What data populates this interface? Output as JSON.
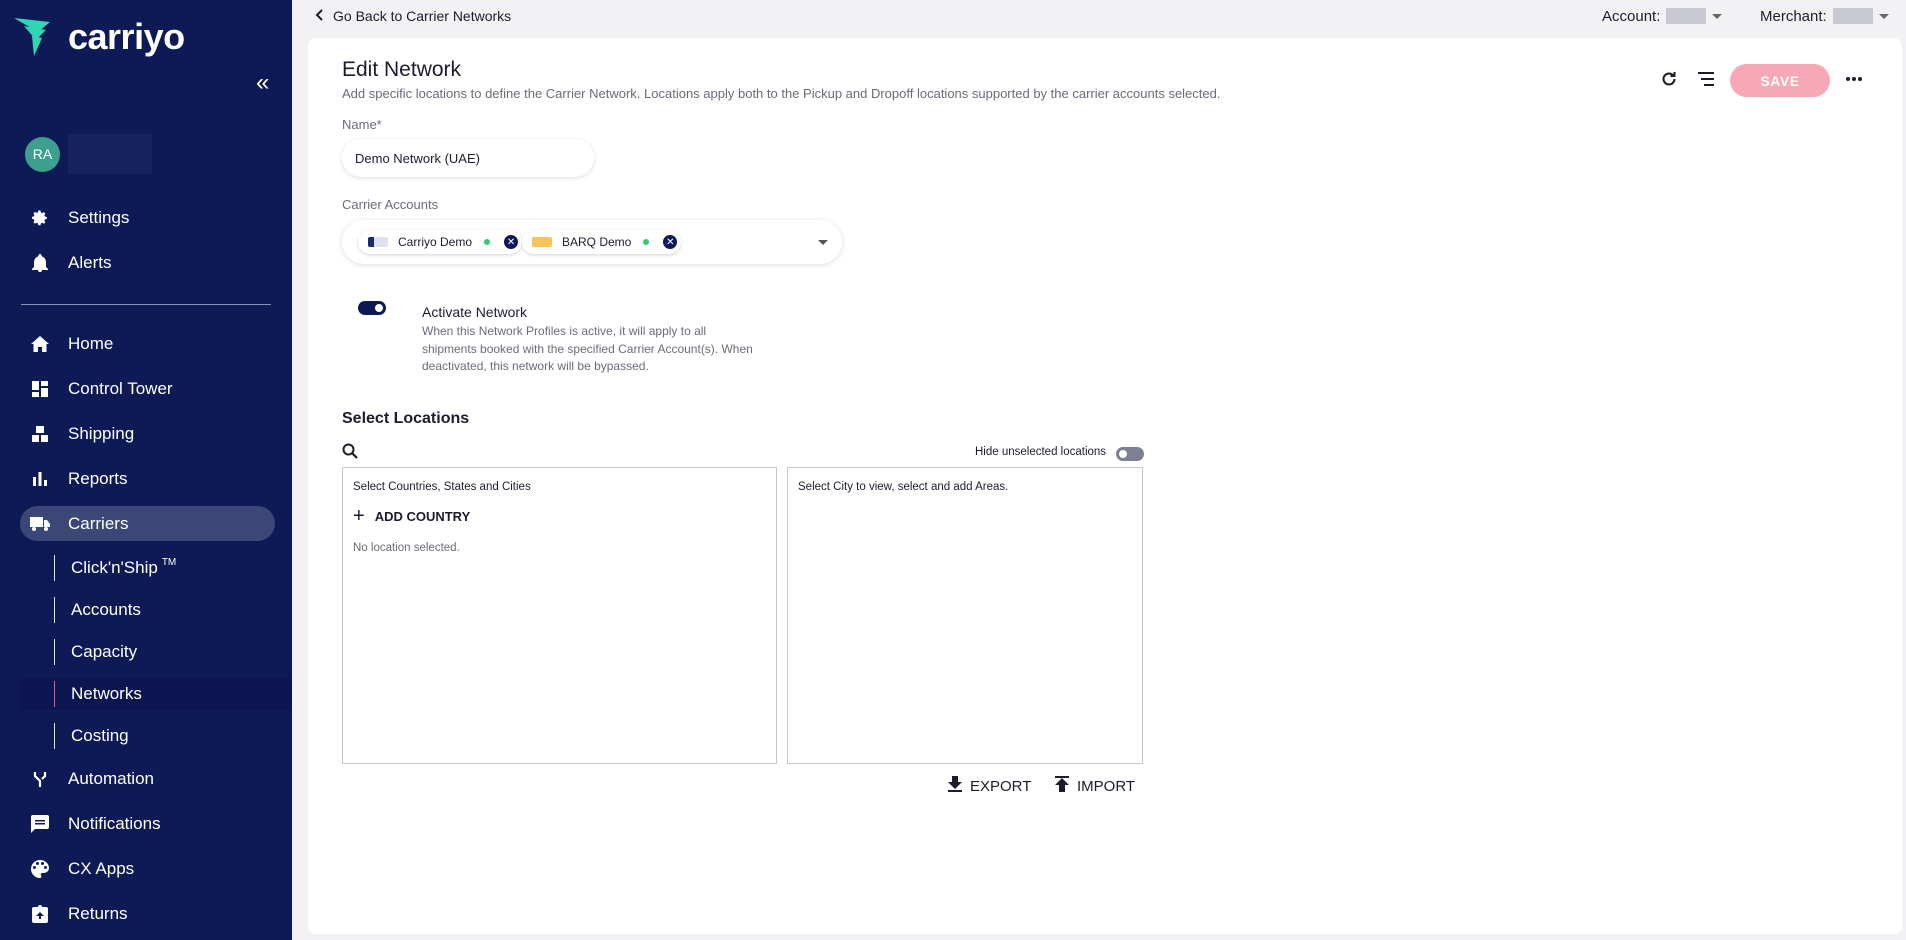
{
  "brand": {
    "name": "carriyo",
    "accent": "#2fd6b4"
  },
  "sidebar": {
    "user_initials": "RA",
    "top_items": [
      {
        "label": "Settings",
        "icon": "gear-icon"
      },
      {
        "label": "Alerts",
        "icon": "bell-icon"
      }
    ],
    "items": [
      {
        "label": "Home",
        "icon": "home-icon"
      },
      {
        "label": "Control Tower",
        "icon": "dashboard-icon"
      },
      {
        "label": "Shipping",
        "icon": "boxes-icon"
      },
      {
        "label": "Reports",
        "icon": "bar-chart-icon"
      },
      {
        "label": "Carriers",
        "icon": "truck-icon"
      }
    ],
    "carrier_sub": [
      {
        "label": "Click'n'Ship",
        "sup": "TM"
      },
      {
        "label": "Accounts"
      },
      {
        "label": "Capacity"
      },
      {
        "label": "Networks"
      },
      {
        "label": "Costing"
      }
    ],
    "bottom_items": [
      {
        "label": "Automation",
        "icon": "fork-icon"
      },
      {
        "label": "Notifications",
        "icon": "message-icon"
      },
      {
        "label": "CX Apps",
        "icon": "palette-icon"
      },
      {
        "label": "Returns",
        "icon": "return-icon"
      }
    ]
  },
  "topbar": {
    "back_label": "Go Back to Carrier Networks",
    "account_label": "Account:",
    "merchant_label": "Merchant:"
  },
  "page": {
    "title": "Edit Network",
    "subtitle": "Add specific locations to define the Carrier Network. Locations apply both to the Pickup and Dropoff locations supported by the carrier accounts selected.",
    "save_label": "SAVE"
  },
  "form": {
    "name_label": "Name*",
    "name_value": "Demo Network (UAE)",
    "carrier_label": "Carrier Accounts",
    "carriers": [
      {
        "label": "Carriyo Demo",
        "logo_color": "#1c2a6b"
      },
      {
        "label": "BARQ Demo",
        "logo_color": "#f5a623"
      }
    ],
    "activate_title": "Activate Network",
    "activate_desc": "When this Network Profiles is active, it will apply to all shipments booked with the specified Carrier Account(s). When deactivated, this network will be bypassed.",
    "activate_on": true
  },
  "locations": {
    "title": "Select Locations",
    "hide_label": "Hide unselected locations",
    "hide_on": false,
    "left_panel_title": "Select Countries, States and Cities",
    "add_country_label": "ADD COUNTRY",
    "empty_text": "No location selected.",
    "right_panel_text": "Select City to view, select and add Areas.",
    "export_label": "EXPORT",
    "import_label": "IMPORT"
  }
}
